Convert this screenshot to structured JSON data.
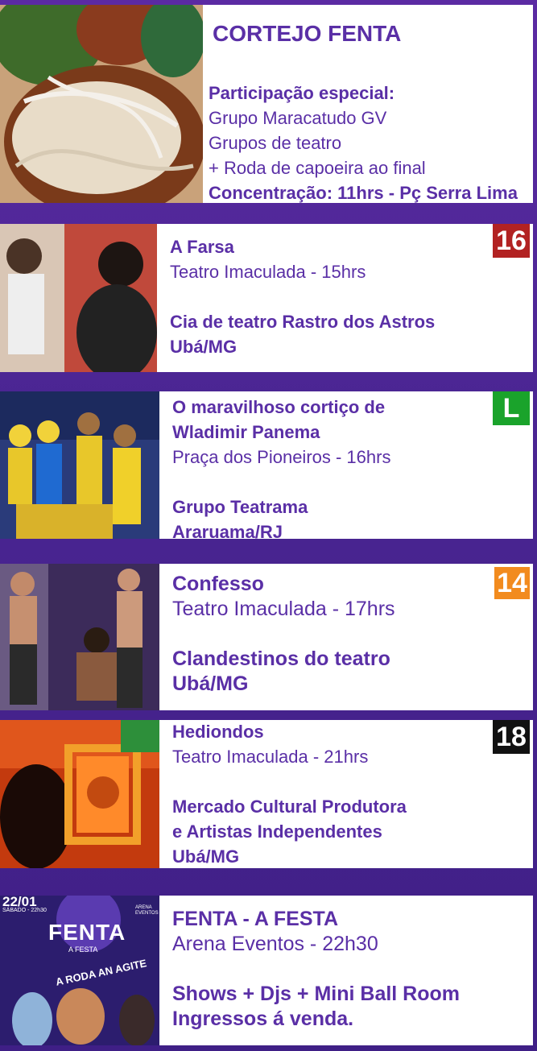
{
  "colors": {
    "text": "#5a2fa6",
    "bg": "#4a2592",
    "r16": "#b22222",
    "rL": "#1aa32b",
    "r14": "#f28b1e",
    "r18": "#111111"
  },
  "cards": [
    {
      "title": "CORTEJO FENTA",
      "lines": [
        "Participação especial:",
        "Grupo Maracatudo GV",
        "Grupos de teatro",
        "+ Roda de capoeira ao final",
        "Concentração: 11hrs - Pç Serra Lima"
      ]
    },
    {
      "title": "A Farsa",
      "venue": "Teatro Imaculada - 15hrs",
      "group": "Cia de teatro Rastro dos Astros",
      "city": "Ubá/MG",
      "rating": "16"
    },
    {
      "title1": "O maravilhoso cortiço de",
      "title2": "Wladimir Panema",
      "venue": "Praça dos Pioneiros - 16hrs",
      "group": "Grupo Teatrama",
      "city": "Araruama/RJ",
      "rating": "L"
    },
    {
      "title": "Confesso",
      "venue": "Teatro Imaculada - 17hrs",
      "group": "Clandestinos do teatro",
      "city": "Ubá/MG",
      "rating": "14"
    },
    {
      "title": "Hediondos",
      "venue": "Teatro Imaculada - 21hrs",
      "group1": "Mercado Cultural Produtora",
      "group2": "e Artistas Independentes",
      "city": "Ubá/MG",
      "rating": "18"
    },
    {
      "title": "FENTA - A FESTA",
      "venue": "Arena Eventos - 22h30",
      "line1": "Shows + Djs + Mini Ball Room",
      "line2": "Ingressos á venda.",
      "poster": {
        "date": "22/01",
        "day": "SÁBADO - 22h30",
        "brand": "FENTA",
        "sub": "A FESTA",
        "tag": "A RODA AN AGITE",
        "arena": "ARENA EVENTOS"
      }
    }
  ]
}
